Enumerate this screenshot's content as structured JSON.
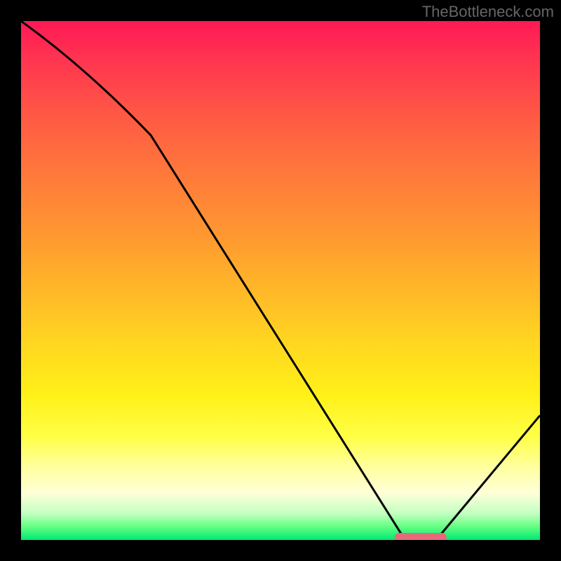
{
  "attribution": "TheBottleneck.com",
  "chart_data": {
    "type": "line",
    "title": "",
    "xlabel": "",
    "ylabel": "",
    "xlim": [
      0,
      100
    ],
    "ylim": [
      0,
      100
    ],
    "grid": false,
    "note": "Bottleneck-percentage-vs-configuration curve over rainbow gradient; values are estimated from pixel coordinates (no axis ticks visible).",
    "x": [
      0,
      25,
      74,
      80,
      100
    ],
    "values": [
      100,
      78,
      0,
      0,
      24
    ],
    "optimal_marker": {
      "x_start": 72,
      "x_end": 82,
      "y": 0,
      "color": "#e86a7a"
    }
  }
}
